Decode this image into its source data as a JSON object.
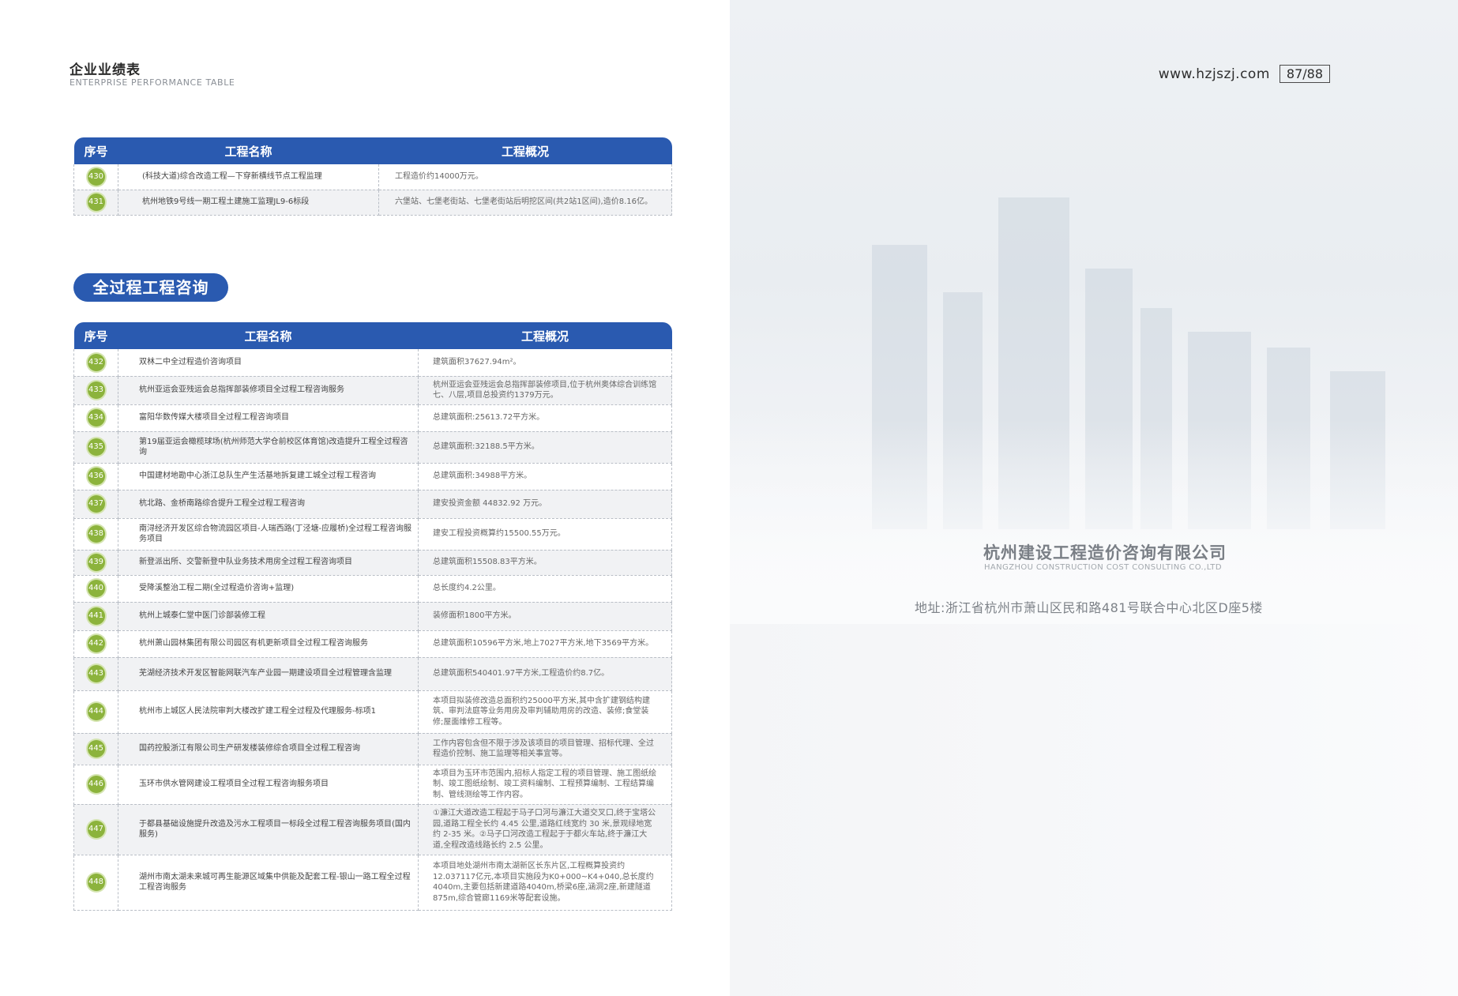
{
  "header": {
    "title": "企业业绩表",
    "subtitle": "ENTERPRISE PERFORMANCE TABLE",
    "website": "www.hzjszj.com",
    "page": "87/88"
  },
  "table_columns": {
    "no": "序号",
    "name": "工程名称",
    "overview": "工程概况"
  },
  "table1": {
    "rows": [
      {
        "no": "430",
        "name": "(科技大道)综合改造工程—下穿新横线节点工程监理",
        "overview": "工程造价约14000万元。"
      },
      {
        "no": "431",
        "name": "杭州地铁9号线一期工程土建施工监理JL9-6标段",
        "overview": "六堡站、七堡老街站、七堡老街站后明挖区间(共2站1区间),造价8.16亿。"
      }
    ]
  },
  "section": {
    "title": "全过程工程咨询"
  },
  "table2": {
    "rows": [
      {
        "no": "432",
        "name": "双林二中全过程造价咨询项目",
        "overview": "建筑面积37627.94m²。"
      },
      {
        "no": "433",
        "name": "杭州亚运会亚残运会总指挥部装修项目全过程工程咨询服务",
        "overview": "杭州亚运会亚残运会总指挥部装修项目,位于杭州奥体综合训练馆七、八层,项目总投资约1379万元。"
      },
      {
        "no": "434",
        "name": "富阳华数传媒大楼项目全过程工程咨询项目",
        "overview": "总建筑面积:25613.72平方米。"
      },
      {
        "no": "435",
        "name": "第19届亚运会橄榄球场(杭州师范大学仓前校区体育馆)改造提升工程全过程咨询",
        "overview": "总建筑面积:32188.5平方米。"
      },
      {
        "no": "436",
        "name": "中国建材地勘中心浙江总队生产生活基地拆复建工城全过程工程咨询",
        "overview": "总建筑面积:34988平方米。"
      },
      {
        "no": "437",
        "name": "杭北路、金桥南路综合提升工程全过程工程咨询",
        "overview": "建安投资金额 44832.92 万元。"
      },
      {
        "no": "438",
        "name": "南浔经济开发区综合物流园区项目-人瑞西路(丁泾塘-应履桥)全过程工程咨询服务项目",
        "overview": "建安工程投资概算约15500.55万元。"
      },
      {
        "no": "439",
        "name": "新登派出所、交警新登中队业务技术用房全过程工程咨询项目",
        "overview": "总建筑面积15508.83平方米。"
      },
      {
        "no": "440",
        "name": "受降溪整治工程二期(全过程造价咨询+监理)",
        "overview": "总长度约4.2公里。"
      },
      {
        "no": "441",
        "name": "杭州上城泰仁堂中医门诊部装修工程",
        "overview": "装修面积1800平方米。"
      },
      {
        "no": "442",
        "name": "杭州萧山园林集团有限公司园区有机更新项目全过程工程咨询服务",
        "overview": "总建筑面积10596平方米,地上7027平方米,地下3569平方米。"
      },
      {
        "no": "443",
        "name": "芜湖经济技术开发区智能网联汽车产业园一期建设项目全过程管理含监理",
        "overview": "总建筑面积540401.97平方米,工程造价约8.7亿。"
      },
      {
        "no": "444",
        "name": "杭州市上城区人民法院审判大楼改扩建工程全过程及代理服务-标项1",
        "overview": "本项目拟装修改造总面积约25000平方米,其中含扩建钢结构建筑、审判法庭等业务用房及审判辅助用房的改造、装修;食堂装修;屋面维修工程等。"
      },
      {
        "no": "445",
        "name": "国药控股浙江有限公司生产研发楼装修综合项目全过程工程咨询",
        "overview": "工作内容包含但不限于涉及该项目的项目管理、招标代理、全过程造价控制、施工监理等相关事宜等。"
      },
      {
        "no": "446",
        "name": "玉环市供水管网建设工程项目全过程工程咨询服务项目",
        "overview": "本项目为玉环市范围内,招标人指定工程的项目管理、施工图纸绘制、竣工图纸绘制、竣工资料编制、工程预算编制、工程结算编制、管线测绘等工作内容。"
      },
      {
        "no": "447",
        "name": "于都县基础设施提升改造及污水工程项目一标段全过程工程咨询服务项目(国内服务)",
        "overview": "①濂江大道改造工程起于马子口河与濂江大道交叉口,终于宝塔公园,道路工程全长约 4.45 公里,道路红线宽约 30 米,景观绿地宽约 2-35 米。②马子口河改造工程起于于都火车站,终于濂江大道,全程改造线路长约 2.5 公里。"
      },
      {
        "no": "448",
        "name": "湖州市南太湖未来城可再生能源区域集中供能及配套工程-银山一路工程全过程工程咨询服务",
        "overview": "本项目地处湖州市南太湖新区长东片区,工程概算投资约12.037117亿元,本项目实施段为K0+000~K4+040,总长度约4040m,主要包括新建道路4040m,桥梁6座,涵洞2座,新建隧道875m,综合管廊1169米等配套设施。"
      }
    ]
  },
  "company": {
    "name": "杭州建设工程造价咨询有限公司",
    "name_en": "HANGZHOU CONSTRUCTION COST CONSULTING CO.,LTD",
    "address": "地址:浙江省杭州市萧山区民和路481号联合中心北区D座5楼"
  },
  "colors": {
    "accent": "#2a5ab0",
    "badge": "#8cb33c"
  }
}
